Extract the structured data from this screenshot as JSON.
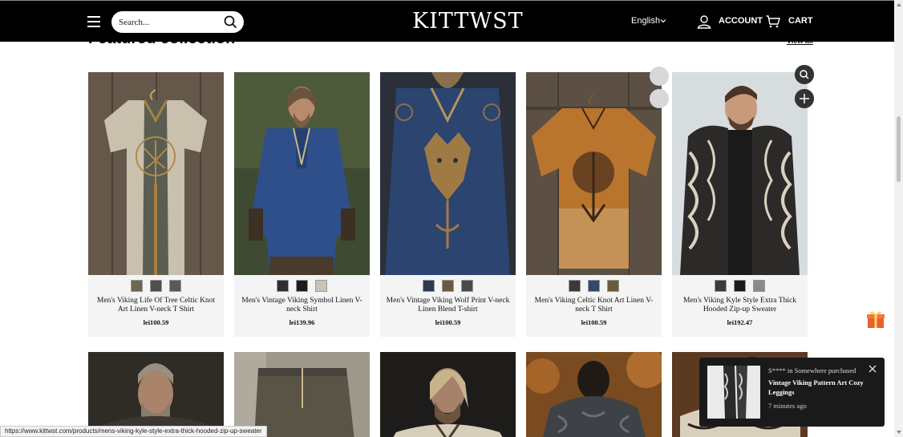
{
  "header": {
    "search_placeholder": "Search...",
    "logo": "KITTWST",
    "language": "English",
    "account_label": "ACCOUNT",
    "cart_label": "CART"
  },
  "section": {
    "title": "Featured collection",
    "view_all": "View all"
  },
  "products": [
    {
      "name": "Men's Viking Life Of Tree Celtic Knot Art Linen V-neck T Shirt",
      "price": "lei100.59",
      "swatches": [
        "#6f6656",
        "#4e5146",
        "#5a5a55"
      ]
    },
    {
      "name": "Men's Vintage Viking Symbol Linen V-neck Shirt",
      "price": "lei139.96",
      "swatches": [
        "#2e2e2e",
        "#1c1c1c",
        "#c9c3b6"
      ]
    },
    {
      "name": "Men's Vintage Viking Wolf Print V-neck Linen Blend T-shirt",
      "price": "lei100.59",
      "swatches": [
        "#2d3a4e",
        "#6b5a40",
        "#4a4a4a"
      ]
    },
    {
      "name": "Men's Viking Celtic Knot Art Linen V-neck T Shirt",
      "price": "lei100.59",
      "swatches": [
        "#3a3a3a",
        "#34486a",
        "#6b5a3a"
      ]
    },
    {
      "name": "Men's Viking Kyle Style Extra Thick Hooded Zip-up Sweater",
      "price": "lei192.47",
      "swatches": [
        "#3b3b3b",
        "#1a1a1a",
        "#8a8a8a"
      ]
    }
  ],
  "toast": {
    "who": "S**** in Somewhere purchased",
    "product": "Vintage Viking Pattern Art Cozy Leggings",
    "time": "7 minutes ago"
  },
  "status_url": "https://www.kittwst.com/products/mens-viking-kyle-style-extra-thick-hooded-zip-up-sweater"
}
